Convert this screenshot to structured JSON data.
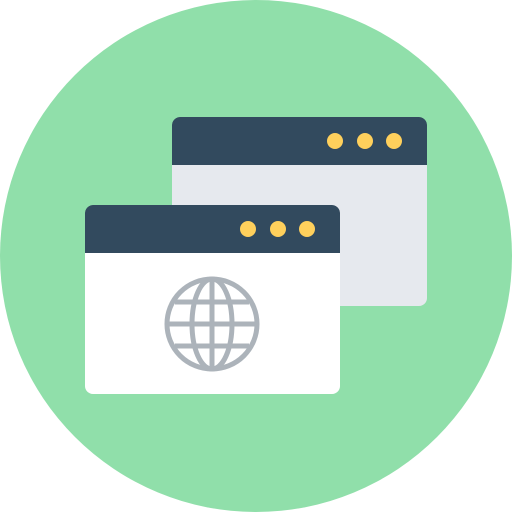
{
  "icon": {
    "name": "browser-windows-globe-icon",
    "colors": {
      "background_circle": "#90DFAA",
      "titlebar": "#324A5E",
      "back_window_body": "#E6E9EE",
      "front_window_body": "#FFFFFF",
      "window_dots": "#FFD05C",
      "globe": "#ACB3BA"
    },
    "windows": [
      {
        "name": "back-window",
        "dots": 3,
        "has_globe": false
      },
      {
        "name": "front-window",
        "dots": 3,
        "has_globe": true
      }
    ]
  }
}
